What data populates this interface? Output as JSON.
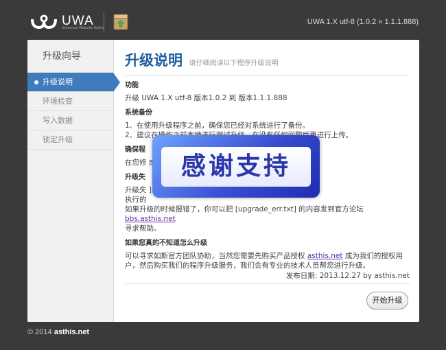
{
  "header": {
    "brand": "UWA",
    "brand_sub": "Universal Website Asthis",
    "version": "UWA 1.X  utf-8  (1.0.2 » 1.1.1.888)"
  },
  "sidebar": {
    "title": "升级向导",
    "items": [
      {
        "label": "升级说明",
        "active": true
      },
      {
        "label": "环境检查",
        "active": false
      },
      {
        "label": "写入数据",
        "active": false
      },
      {
        "label": "锁定升级",
        "active": false
      }
    ]
  },
  "main": {
    "title": "升级说明",
    "subtitle": "请仔细阅读以下程序升级说明",
    "sections": [
      {
        "heading": "功能",
        "lines": [
          "升级 UWA 1.X utf-8 版本1.0.2 到 版本1.1.1.888"
        ]
      },
      {
        "heading": "系统备份",
        "lines": [
          "1、在使用升级程序之前，确保您已经对系统进行了备份。",
          "2、建议在操作之前本地进行测试升级，在没有任何问题后再进行上传。"
        ]
      },
      {
        "heading": "确保程",
        "lines": [
          "在您修                                                                                  成功。"
        ]
      },
      {
        "heading": "升级失",
        "lines": [
          "升级失                                                                      ] 文件，该文件记录着程序",
          "执行的",
          "如果升级的时候报错了，你可以把 [upgrade_err.txt] 的内容发到官方论坛",
          "寻求帮助。"
        ],
        "forum_link": "bbs.asthis.net"
      }
    ],
    "help": {
      "heading": "如果您真的不知道怎么升级",
      "line1_prefix": "可以寻求如斯官方团队协助，当然您需要先购买产品授权",
      "link": "asthis.net",
      "line1_suffix": "成为我们的授权用",
      "line2": "户，然后购买我们的程序升级服务，我们会有专业的技术人员帮您进行升级。"
    },
    "publish": "发布日期: 2013.12.27 by asthis.net",
    "start_button": "开始升级"
  },
  "overlay": {
    "text": "感谢支持"
  },
  "footer": {
    "copyright": "© 2014",
    "site": "asthis.net"
  }
}
